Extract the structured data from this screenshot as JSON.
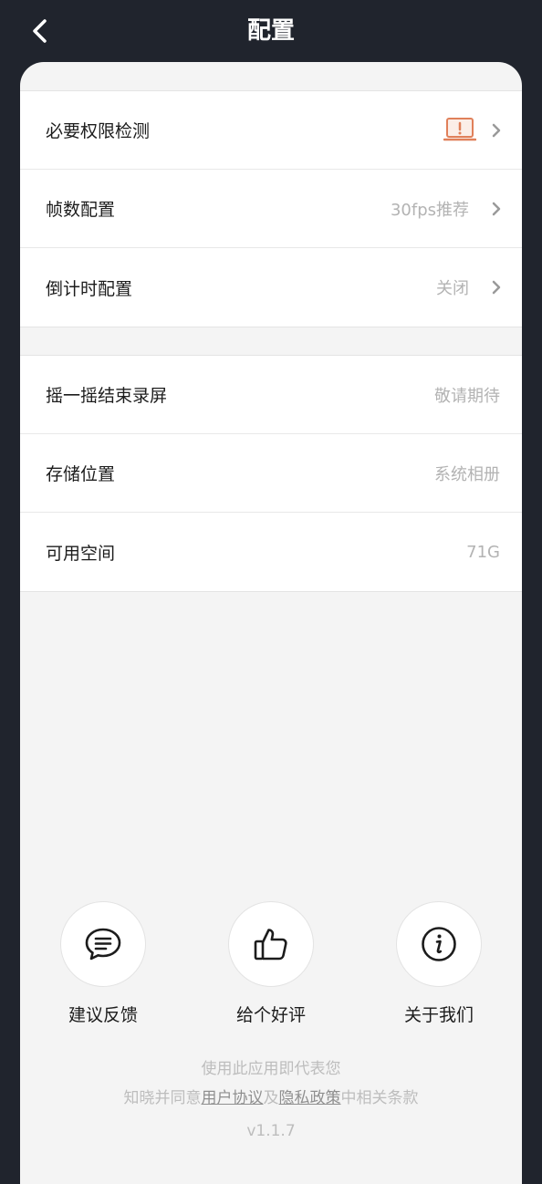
{
  "header": {
    "title": "配置",
    "back_icon": "chevron-left-icon"
  },
  "settings": {
    "group1": [
      {
        "label": "必要权限检测",
        "value": "",
        "icon": "laptop-warning-icon"
      },
      {
        "label": "帧数配置",
        "value": "30fps推荐"
      },
      {
        "label": "倒计时配置",
        "value": "关闭"
      }
    ],
    "group2": [
      {
        "label": "摇一摇结束录屏",
        "value": "敬请期待"
      },
      {
        "label": "存储位置",
        "value": "系统相册"
      },
      {
        "label": "可用空间",
        "value": "71G"
      }
    ]
  },
  "actions": [
    {
      "label": "建议反馈",
      "icon": "chat-bubble-icon"
    },
    {
      "label": "给个好评",
      "icon": "thumbs-up-icon"
    },
    {
      "label": "关于我们",
      "icon": "info-icon"
    }
  ],
  "footer": {
    "line1": "使用此应用即代表您",
    "line2_prefix": "知晓并同意",
    "user_agreement": "用户协议",
    "and": "及",
    "privacy_policy": "隐私政策",
    "line2_suffix": "中相关条款",
    "version": "v1.1.7"
  },
  "colors": {
    "header_bg": "#20242d",
    "panel_bg": "#f4f4f4",
    "warning": "#e0805a"
  }
}
